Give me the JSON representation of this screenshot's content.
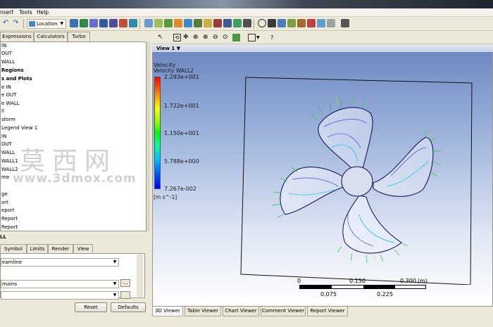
{
  "menubar": {
    "items": [
      "nsert",
      "Tools",
      "Help"
    ]
  },
  "toolbar": {
    "location_label": "Location"
  },
  "left_tabs": [
    "Expressions",
    "Calculators",
    "Turbo"
  ],
  "tree_items": [
    {
      "label": "IN",
      "bold": false
    },
    {
      "label": "OUT",
      "bold": false
    },
    {
      "label": "WALL",
      "bold": false
    },
    {
      "label": "Regions",
      "bold": true
    },
    {
      "label": "s and Plots",
      "bold": true
    },
    {
      "label": "e IN",
      "bold": false
    },
    {
      "label": "e OUT",
      "bold": false
    },
    {
      "label": "e WALL",
      "bold": false
    },
    {
      "label": "ll",
      "bold": false
    },
    {
      "label": "sform",
      "bold": false
    },
    {
      "label": "Legend View 1",
      "bold": false
    },
    {
      "label": "IN",
      "bold": false
    },
    {
      "label": "OUT",
      "bold": false
    },
    {
      "label": "WALL",
      "bold": false
    },
    {
      "label": "WALL1",
      "bold": false
    },
    {
      "label": "WALL2",
      "bold": false
    },
    {
      "label": "me",
      "bold": false
    },
    {
      "label": "",
      "bold": false
    },
    {
      "label": "ge",
      "bold": false
    },
    {
      "label": "ort",
      "bold": false
    },
    {
      "label": "eport",
      "bold": false
    },
    {
      "label": "Report",
      "bold": false
    },
    {
      "label": "Report",
      "bold": false
    }
  ],
  "selection_label": "LL",
  "detail_tabs": [
    "Symbol",
    "Limits",
    "Render",
    "View"
  ],
  "details": {
    "combo1": "eamline",
    "combo2": "mains",
    "combo3": "",
    "dots": "..."
  },
  "buttons": {
    "reset": "Reset",
    "defaults": "Defaults"
  },
  "viewer": {
    "view_label": "View 1",
    "legend": {
      "title": "Velocity",
      "subtitle": "Velocity WALL2",
      "values": [
        "2.293e+001",
        "1.722e+001",
        "1.150e+001",
        "5.788e+000",
        "7.267e-002"
      ],
      "units": "[m s^-1]"
    },
    "scale": {
      "top_labels": [
        "0",
        "0.150",
        "0.300",
        "(m)"
      ],
      "bottom_labels": [
        "0.075",
        "0.225"
      ]
    },
    "tabs": [
      "3D Viewer",
      "Table Viewer",
      "Chart Viewer",
      "Comment Viewer",
      "Report Viewer"
    ]
  },
  "watermark": {
    "cn": "莫西网",
    "url": "www.3dmox.com"
  },
  "colors": {
    "legend_max": "#ff0000",
    "legend_min": "#0000ff",
    "viewport_top": "#6a86c0",
    "viewport_bottom": "#ffffff"
  }
}
